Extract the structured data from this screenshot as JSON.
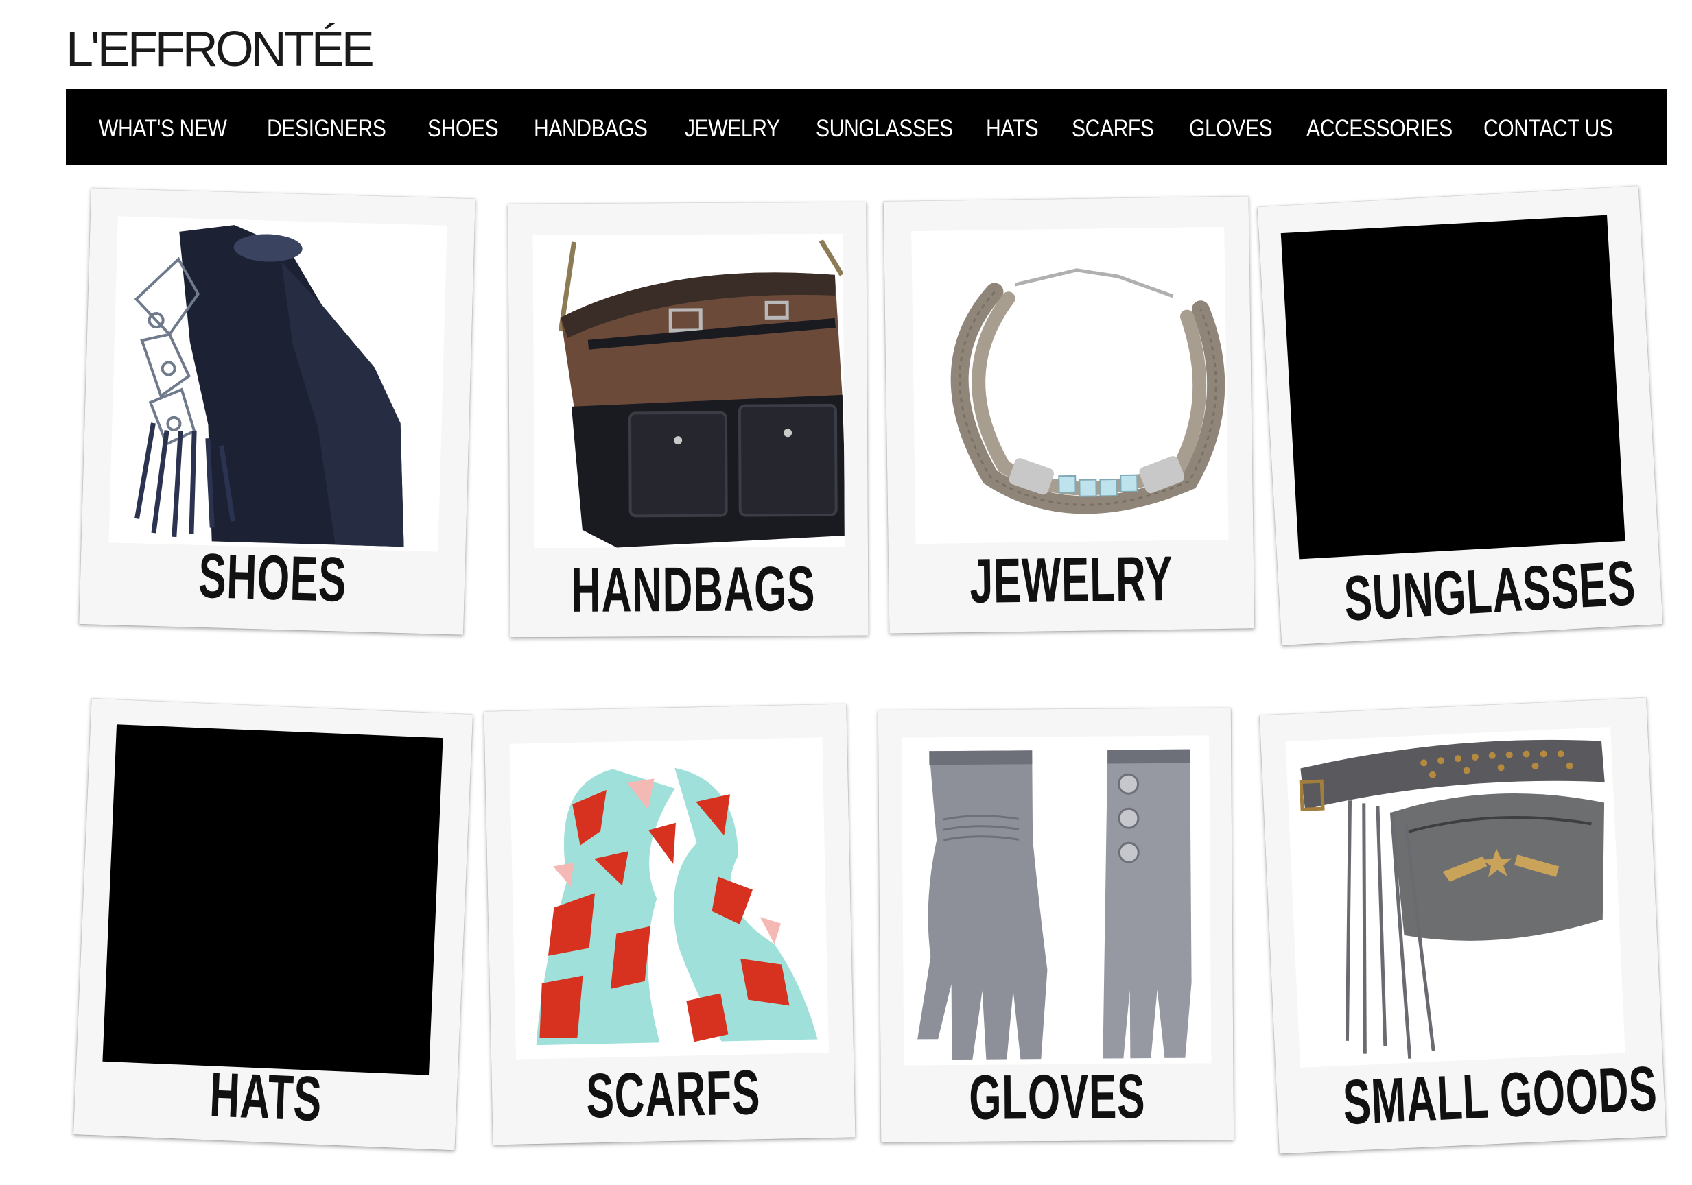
{
  "brand": {
    "logo_text": "L'EFFRONTÉE",
    "logo_accent_color": "#e0177e"
  },
  "nav": {
    "items": [
      {
        "label": "WHAT'S NEW"
      },
      {
        "label": "DESIGNERS"
      },
      {
        "label": "SHOES"
      },
      {
        "label": "HANDBAGS"
      },
      {
        "label": "JEWELRY"
      },
      {
        "label": "SUNGLASSES"
      },
      {
        "label": "HATS"
      },
      {
        "label": "SCARFS"
      },
      {
        "label": "GLOVES"
      },
      {
        "label": "ACCESSORIES"
      },
      {
        "label": "CONTACT US"
      }
    ]
  },
  "categories": [
    {
      "label": "SHOES",
      "image": "shoe-bootie"
    },
    {
      "label": "HANDBAGS",
      "image": "leather-handbag"
    },
    {
      "label": "JEWELRY",
      "image": "rope-necklace"
    },
    {
      "label": "SUNGLASSES",
      "image": "blank-black"
    },
    {
      "label": "HATS",
      "image": "blank-black"
    },
    {
      "label": "SCARFS",
      "image": "printed-scarf"
    },
    {
      "label": "GLOVES",
      "image": "leather-gloves"
    },
    {
      "label": "SMALL GOODS",
      "image": "fringe-belt-bag"
    }
  ]
}
